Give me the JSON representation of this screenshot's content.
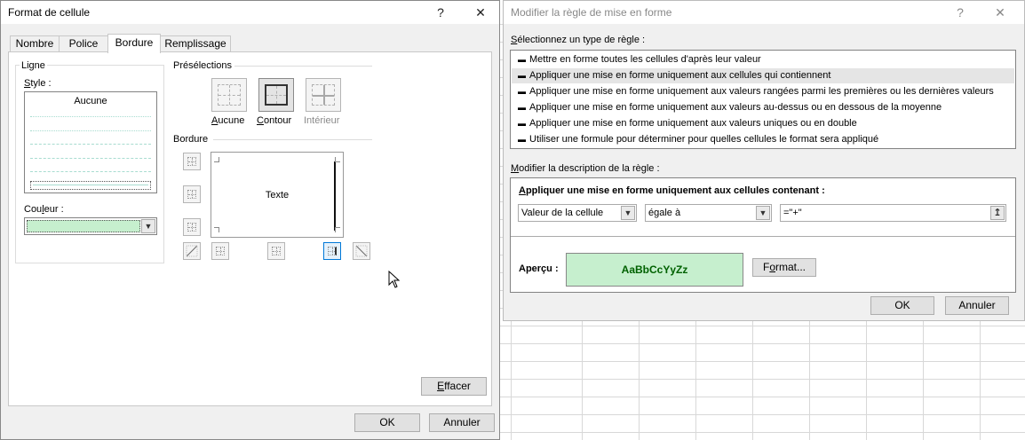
{
  "format_dialog": {
    "title": "Format de cellule",
    "help_button": "?",
    "close_button": "✕",
    "tabs": [
      "Nombre",
      "Police",
      "Bordure",
      "Remplissage"
    ],
    "active_tab": "Bordure",
    "line_group": {
      "title": "Ligne",
      "style_label": "Style :",
      "style_selected": "Aucune",
      "color_label": "Couleur :",
      "color_value": "#c6efce"
    },
    "presets": {
      "title": "Présélections",
      "items": [
        "Aucune",
        "Contour",
        "Intérieur"
      ]
    },
    "border": {
      "title": "Bordure",
      "preview_text": "Texte"
    },
    "clear_button": "Effacer",
    "ok_button": "OK",
    "cancel_button": "Annuler"
  },
  "rule_dialog": {
    "title": "Modifier la règle de mise en forme",
    "help_button": "?",
    "close_button": "✕",
    "rule_type_label": "Sélectionnez un type de règle :",
    "rule_types": [
      "Mettre en forme toutes les cellules d'après leur valeur",
      "Appliquer une mise en forme uniquement aux cellules qui contiennent",
      "Appliquer une mise en forme uniquement aux valeurs rangées parmi les premières ou les dernières valeurs",
      "Appliquer une mise en forme uniquement aux valeurs au-dessus ou en dessous de la moyenne",
      "Appliquer une mise en forme uniquement aux valeurs uniques ou en double",
      "Utiliser une formule pour déterminer pour quelles cellules le format sera appliqué"
    ],
    "selected_rule_index": 1,
    "description_label": "Modifier la description de la règle :",
    "description_heading": "Appliquer une mise en forme uniquement aux cellules contenant :",
    "condition_field": "Valeur de la cellule",
    "operator": "égale à",
    "value": "=\"+\"",
    "preview_label": "Aperçu :",
    "preview_sample": "AaBbCcYyZz",
    "preview_fill": "#c6efce",
    "preview_font_color": "#006100",
    "format_button": "Format...",
    "ok_button": "OK",
    "cancel_button": "Annuler"
  }
}
